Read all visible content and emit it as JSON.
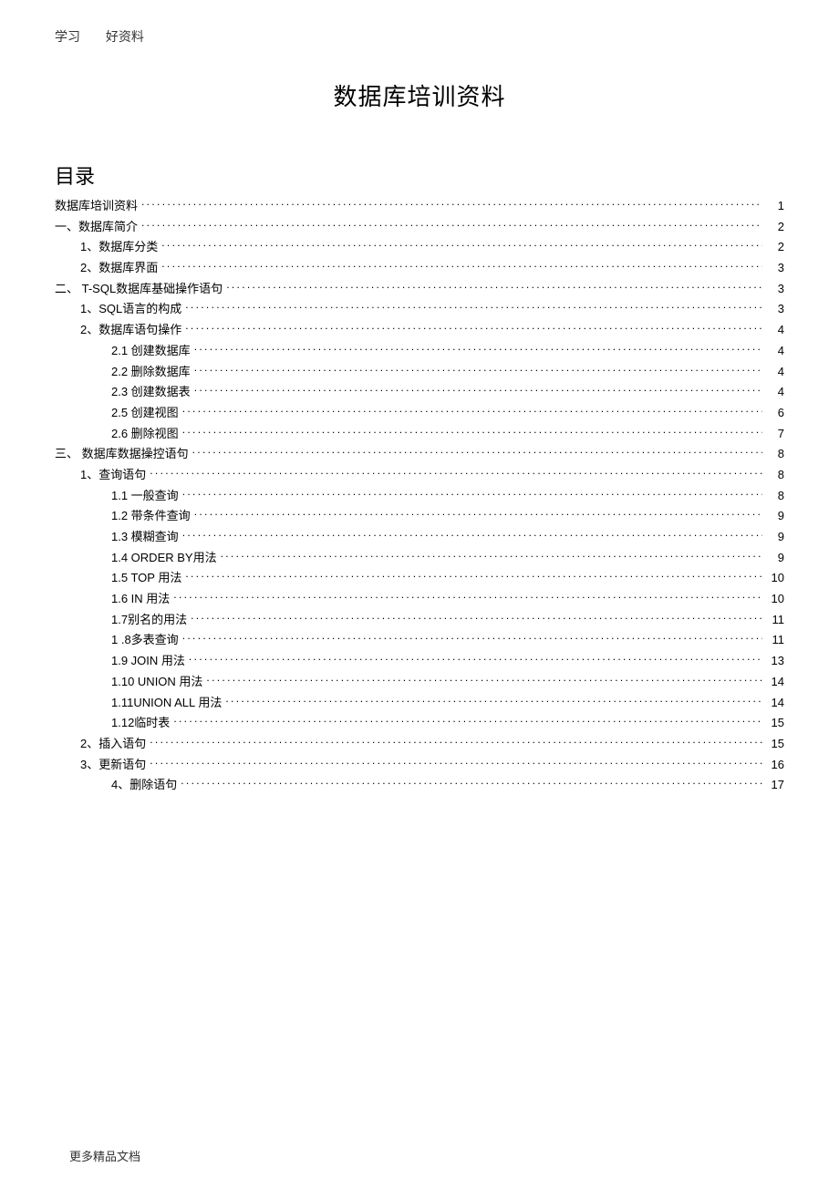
{
  "header": {
    "left": "学习",
    "right": "好资料"
  },
  "title": "数据库培训资料",
  "toc_heading": "目录",
  "footer": "更多精品文档",
  "toc": [
    {
      "label": "数据库培训资料",
      "page": "1",
      "indent": 0
    },
    {
      "label": "一、数据库简介",
      "page": "2",
      "indent": 0
    },
    {
      "label": "1、数据库分类",
      "page": "2",
      "indent": 1
    },
    {
      "label": "2、数据库界面",
      "page": "3",
      "indent": 1
    },
    {
      "label": "二、 T-SQL数据库基础操作语句",
      "page": "3",
      "indent": 0
    },
    {
      "label": "1、SQL语言的构成",
      "page": "3",
      "indent": 1
    },
    {
      "label": "2、数据库语句操作",
      "page": "4",
      "indent": 1
    },
    {
      "label": "2.1  创建数据库",
      "page": "4",
      "indent": 2
    },
    {
      "label": "2.2  删除数据库",
      "page": "4",
      "indent": 2
    },
    {
      "label": "2.3  创建数据表",
      "page": "4",
      "indent": 2
    },
    {
      "label": "2.5  创建视图",
      "page": "6",
      "indent": 2
    },
    {
      "label": "2.6  删除视图",
      "page": "7",
      "indent": 2
    },
    {
      "label": "三、 数据库数据操控语句",
      "page": "8",
      "indent": 0
    },
    {
      "label": "1、查询语句",
      "page": "8",
      "indent": 1
    },
    {
      "label": "1.1 一般查询",
      "page": "8",
      "indent": 2
    },
    {
      "label": "1.2 带条件查询",
      "page": "9",
      "indent": 2
    },
    {
      "label": "1.3  模糊查询",
      "page": "9",
      "indent": 2
    },
    {
      "label": "1.4  ORDER BY用法",
      "page": "9",
      "indent": 2
    },
    {
      "label": "1.5   TOP 用法",
      "page": "10",
      "indent": 2
    },
    {
      "label": "1.6  IN 用法",
      "page": "10",
      "indent": 2
    },
    {
      "label": "1.7别名的用法",
      "page": "11",
      "indent": 2
    },
    {
      "label": "1 .8多表查询",
      "page": "11",
      "indent": 2
    },
    {
      "label": "1.9  JOIN 用法",
      "page": "13",
      "indent": 2
    },
    {
      "label": "1.10  UNION 用法",
      "page": "14",
      "indent": 2
    },
    {
      "label": "1.11UNION ALL 用法",
      "page": "14",
      "indent": 2
    },
    {
      "label": "1.12临时表",
      "page": "15",
      "indent": 2
    },
    {
      "label": "2、插入语句",
      "page": "15",
      "indent": 1
    },
    {
      "label": "3、更新语句",
      "page": "16",
      "indent": 1
    },
    {
      "label": "4、删除语句",
      "page": "17",
      "indent": 2
    }
  ]
}
